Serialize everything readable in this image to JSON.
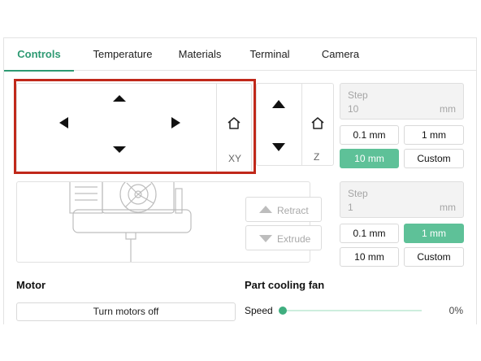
{
  "tabs": [
    {
      "label": "Controls",
      "active": true
    },
    {
      "label": "Temperature",
      "active": false
    },
    {
      "label": "Materials",
      "active": false
    },
    {
      "label": "Terminal",
      "active": false
    },
    {
      "label": "Camera",
      "active": false
    }
  ],
  "jog": {
    "xy_label": "XY",
    "z_label": "Z",
    "step": {
      "label": "Step",
      "value": "10",
      "unit": "mm",
      "options": [
        "0.1 mm",
        "1 mm",
        "10 mm",
        "Custom"
      ],
      "selected": "10 mm"
    }
  },
  "extruder": {
    "retract_label": "Retract",
    "extrude_label": "Extrude",
    "step": {
      "label": "Step",
      "value": "1",
      "unit": "mm",
      "options": [
        "0.1 mm",
        "1 mm",
        "10 mm",
        "Custom"
      ],
      "selected": "1 mm"
    }
  },
  "motor": {
    "title": "Motor",
    "button_label": "Turn motors off"
  },
  "fan": {
    "title": "Part cooling fan",
    "speed_label": "Speed",
    "speed_value": "0%",
    "speed_fraction": 0
  },
  "colors": {
    "accent": "#2e9a73",
    "selected_button": "#5ec198",
    "highlight": "#c0281a"
  }
}
